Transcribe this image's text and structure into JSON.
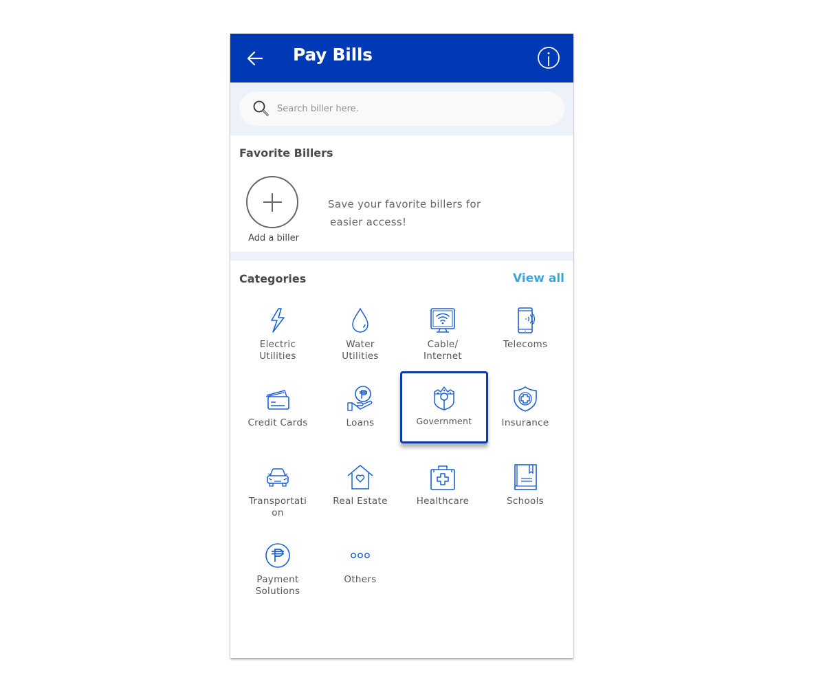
{
  "header": {
    "title": "Pay Bills",
    "back_icon": "arrow-left-icon",
    "info_icon": "info-icon",
    "background_color": "#0039b5"
  },
  "search": {
    "placeholder": "Search biller here.",
    "value": "",
    "icon": "search-icon"
  },
  "favorites": {
    "title": "Favorite Billers",
    "add_label": "Add a biller",
    "add_icon": "plus-icon",
    "message_line1": "Save your favorite billers for",
    "message_line2": "easier access!"
  },
  "categories": {
    "title": "Categories",
    "view_all_label": "View all",
    "view_all_color": "#3aa4dc",
    "icon_color": "#1a5fd6",
    "items": [
      {
        "label1": "Electric",
        "label2": "Utilities",
        "icon": "lightning-icon"
      },
      {
        "label1": "Water",
        "label2": "Utilities",
        "icon": "water-drop-icon"
      },
      {
        "label1": "Cable/",
        "label2": "Internet",
        "icon": "wifi-monitor-icon"
      },
      {
        "label1": "Telecoms",
        "label2": "",
        "icon": "mobile-phone-icon"
      },
      {
        "label1": "Credit Cards",
        "label2": "",
        "icon": "credit-card-icon"
      },
      {
        "label1": "Loans",
        "label2": "",
        "icon": "hand-coin-icon"
      },
      {
        "label1": "Government",
        "label2": "",
        "icon": "government-shield-icon",
        "selected": true
      },
      {
        "label1": "Insurance",
        "label2": "",
        "icon": "shield-plus-icon"
      },
      {
        "label1": "Transportati",
        "label2": "on",
        "icon": "car-icon"
      },
      {
        "label1": "Real Estate",
        "label2": "",
        "icon": "house-heart-icon"
      },
      {
        "label1": "Healthcare",
        "label2": "",
        "icon": "medical-kit-icon"
      },
      {
        "label1": "Schools",
        "label2": "",
        "icon": "book-icon"
      },
      {
        "label1": "Payment",
        "label2": "Solutions",
        "icon": "peso-coin-icon"
      },
      {
        "label1": "Others",
        "label2": "",
        "icon": "more-dots-icon"
      }
    ]
  }
}
